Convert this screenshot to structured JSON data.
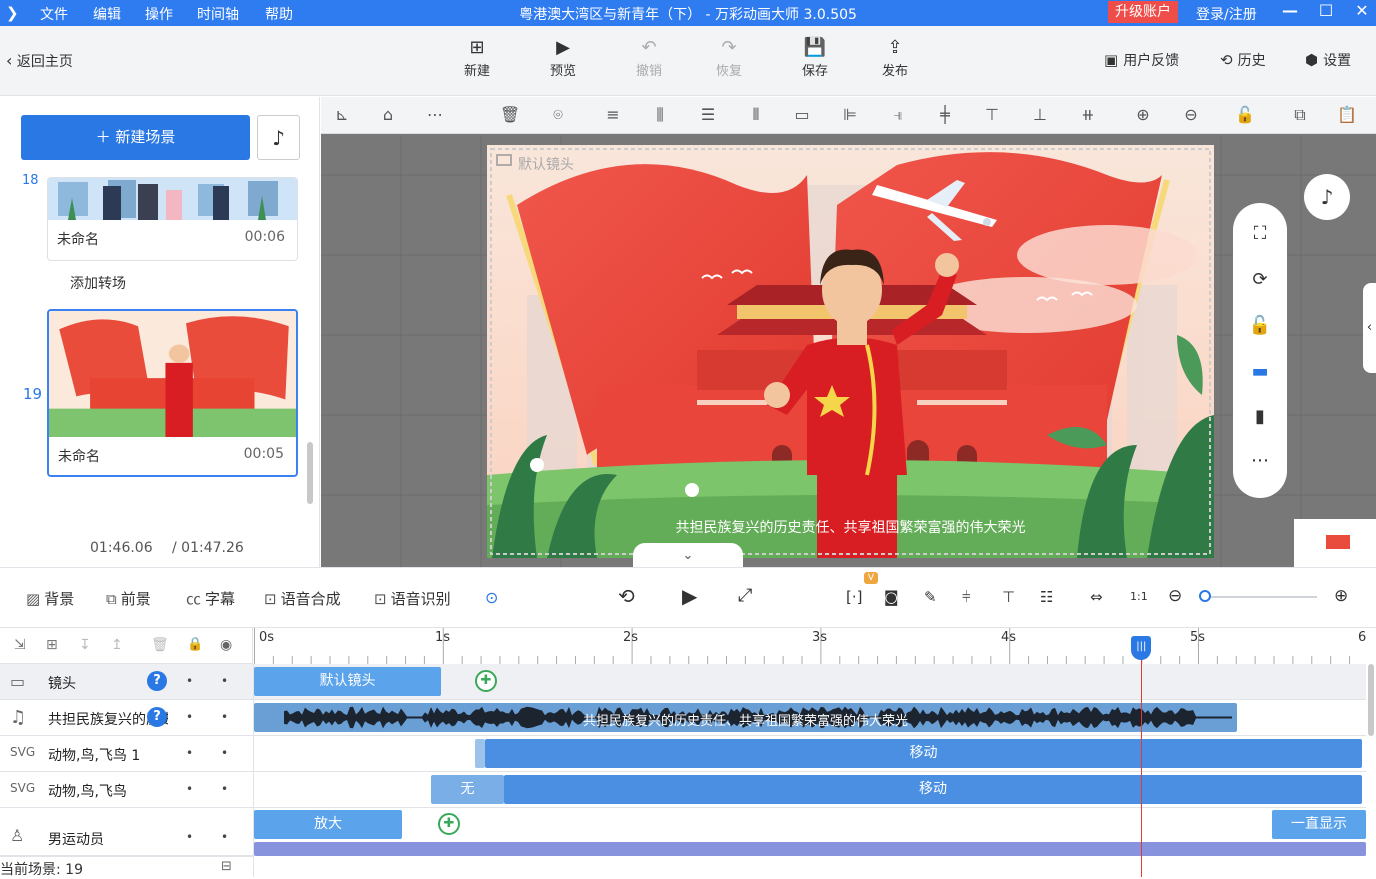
{
  "titlebar": {
    "menus": [
      "文件",
      "编辑",
      "操作",
      "时间轴",
      "帮助"
    ],
    "title": "粤港澳大湾区与新青年（下） - 万彩动画大师 3.0.505",
    "upgrade": "升级账户",
    "login": "登录/注册",
    "colors": {
      "bar": "#2f7bf0",
      "upgrade": "#ef4d4a"
    }
  },
  "toolbar": {
    "back": "返回主页",
    "buttons": [
      {
        "label": "新建",
        "icon": "new-icon"
      },
      {
        "label": "预览",
        "icon": "play-icon"
      },
      {
        "label": "撤销",
        "icon": "undo-icon"
      },
      {
        "label": "恢复",
        "icon": "redo-icon"
      },
      {
        "label": "保存",
        "icon": "save-icon"
      },
      {
        "label": "发布",
        "icon": "publish-icon"
      }
    ],
    "feedback": "用户反馈",
    "history": "历史",
    "settings": "设置"
  },
  "left": {
    "new_scene": "新建场景",
    "add_transition": "添加转场",
    "scenes": [
      {
        "number": "18",
        "name": "未命名",
        "time": "00:06"
      },
      {
        "number": "19",
        "name": "未命名",
        "time": "00:05"
      }
    ],
    "current_time": "01:46.06",
    "total_time": "/ 01:47.26"
  },
  "canvas": {
    "camera_label": "默认镜头",
    "subtitle": "共担民族复兴的历史责任、共享祖国繁荣富强的伟大荣光"
  },
  "bottom_tools": {
    "background": "背景",
    "foreground": "前景",
    "subtitle": "字幕",
    "tts": "语音合成",
    "asr": "语音识别"
  },
  "timeline": {
    "ticks": [
      "0s",
      "1s",
      "2s",
      "3s",
      "4s",
      "5s",
      "6"
    ],
    "tracks": [
      {
        "name": "镜头",
        "icon": "camera-icon"
      },
      {
        "name": "共担民族复兴的历史",
        "icon": "music-note-icon"
      },
      {
        "name": "动物,鸟,飞鸟 1",
        "icon": "svg-icon"
      },
      {
        "name": "动物,鸟,飞鸟",
        "icon": "svg-icon"
      },
      {
        "name": "男运动员",
        "icon": "person-icon"
      }
    ],
    "blocks": {
      "camera": "默认镜头",
      "audio": "共担民族复兴的历史责任、共享祖国繁荣富强的伟大荣光",
      "move1": "移动",
      "none": "无",
      "move2": "移动",
      "zoom": "放大",
      "always": "一直显示"
    },
    "current_scene": "当前场景: 19",
    "playhead_seconds": 4.7
  }
}
